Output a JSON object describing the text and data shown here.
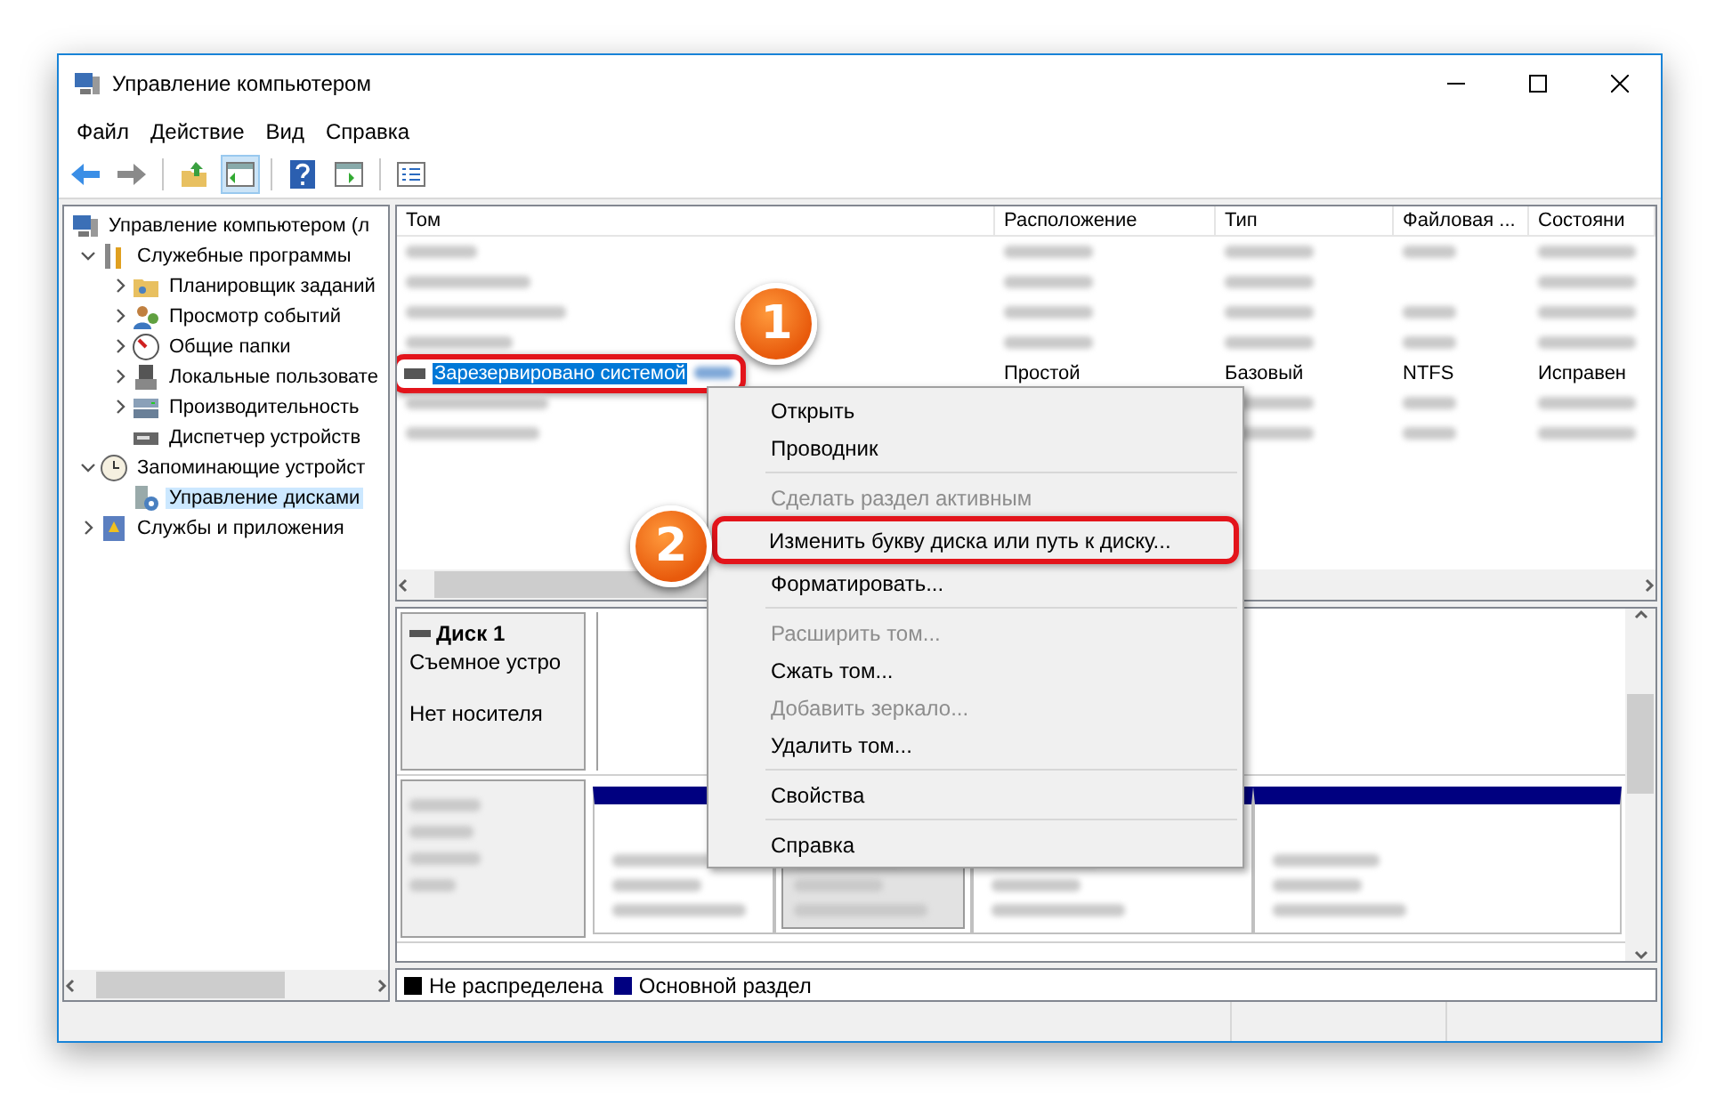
{
  "window": {
    "title": "Управление компьютером"
  },
  "menu": [
    "Файл",
    "Действие",
    "Вид",
    "Справка"
  ],
  "tree": [
    {
      "label": "Управление компьютером (л",
      "selected": false,
      "children": [
        {
          "label": "Служебные программы",
          "expanded": true,
          "selected": false,
          "children": [
            {
              "label": "Планировщик заданий",
              "expanded": false,
              "selected": false
            },
            {
              "label": "Просмотр событий",
              "expanded": false,
              "selected": false
            },
            {
              "label": "Общие папки",
              "expanded": false,
              "selected": false
            },
            {
              "label": "Локальные пользовате",
              "expanded": false,
              "selected": false
            },
            {
              "label": "Производительность",
              "expanded": false,
              "selected": false
            },
            {
              "label": "Диспетчер устройств",
              "selected": false
            }
          ]
        },
        {
          "label": "Запоминающие устройст",
          "expanded": true,
          "selected": false,
          "children": [
            {
              "label": "Управление дисками",
              "selected": true
            }
          ]
        },
        {
          "label": "Службы и приложения",
          "expanded": false,
          "selected": false
        }
      ]
    }
  ],
  "table": {
    "columns": [
      "Том",
      "Расположение",
      "Тип",
      "Файловая ...",
      "Состояни"
    ],
    "rows": [
      {
        "kind": "blurred",
        "selected": false
      },
      {
        "kind": "blurred",
        "selected": false
      },
      {
        "kind": "blurred",
        "selected": false
      },
      {
        "kind": "blurred",
        "selected": false
      },
      {
        "kind": "volume",
        "selected": true,
        "callout": "1",
        "cells": [
          "Зарезервировано системой",
          "Простой",
          "Базовый",
          "NTFS",
          "Исправен"
        ]
      },
      {
        "kind": "blurred",
        "selected": false
      },
      {
        "kind": "blurred",
        "selected": false
      }
    ]
  },
  "context_menu": [
    {
      "kind": "item",
      "label": "Открыть",
      "disabled": false
    },
    {
      "kind": "item",
      "label": "Проводник",
      "disabled": false
    },
    {
      "kind": "separator"
    },
    {
      "kind": "item",
      "label": "Сделать раздел активным",
      "disabled": true
    },
    {
      "kind": "item",
      "label": "Изменить букву диска или путь к диску...",
      "disabled": false,
      "callout": "2"
    },
    {
      "kind": "item",
      "label": "Форматировать...",
      "disabled": false
    },
    {
      "kind": "separator"
    },
    {
      "kind": "item",
      "label": "Расширить том...",
      "disabled": true
    },
    {
      "kind": "item",
      "label": "Сжать том...",
      "disabled": false
    },
    {
      "kind": "item",
      "label": "Добавить зеркало...",
      "disabled": true
    },
    {
      "kind": "item",
      "label": "Удалить том...",
      "disabled": false
    },
    {
      "kind": "separator"
    },
    {
      "kind": "item",
      "label": "Свойства",
      "disabled": false
    },
    {
      "kind": "separator"
    },
    {
      "kind": "item",
      "label": "Справка",
      "disabled": false
    }
  ],
  "disks": [
    {
      "kind": "plain",
      "name": "Диск 1",
      "lines": [
        "Съемное устро",
        "Нет носителя"
      ]
    },
    {
      "kind": "blurred",
      "partitions": [
        {
          "selected": false
        },
        {
          "selected": true
        },
        {
          "selected": false
        },
        {
          "selected": false
        }
      ]
    }
  ],
  "legend": [
    {
      "label": "Не распределена",
      "color": "#000000"
    },
    {
      "label": "Основной раздел",
      "color": "#000080"
    }
  ]
}
